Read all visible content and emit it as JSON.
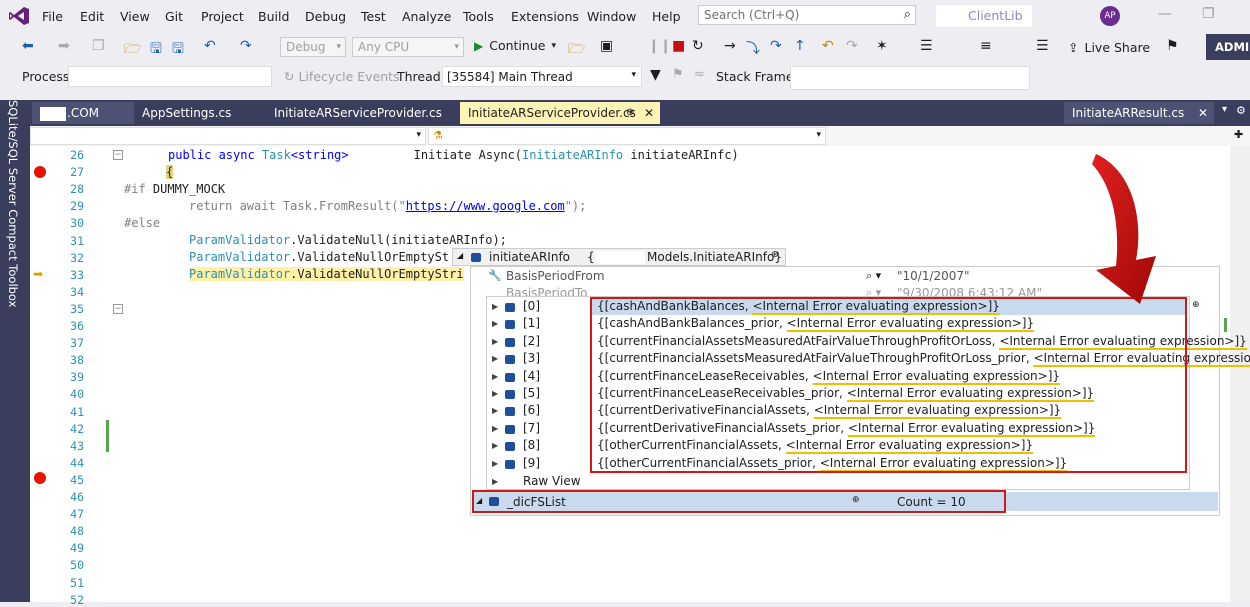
{
  "menu": [
    "File",
    "Edit",
    "View",
    "Git",
    "Project",
    "Build",
    "Debug",
    "Test",
    "Analyze",
    "Tools",
    "Extensions",
    "Window",
    "Help"
  ],
  "search": {
    "placeholder": "Search (Ctrl+Q)"
  },
  "solution_name": "ClientLib",
  "avatar_initials": "AP",
  "toolbar": {
    "config": "Debug",
    "platform": "Any CPU",
    "continue_label": "Continue",
    "live_share": "Live Share",
    "admin": "ADMIN"
  },
  "process_bar": {
    "process_label": "Process:",
    "lifecycle_label": "Lifecycle Events",
    "thread_label": "Thread:",
    "thread_value": "[35584] Main Thread",
    "stack_label": "Stack Frame:"
  },
  "sidebar_title": "SQLite/SQL Server Compact Toolbox",
  "tabs": [
    {
      "label": ".COM"
    },
    {
      "label": "AppSettings.cs"
    },
    {
      "label": "InitiateARServiceProvider.cs"
    },
    {
      "label": "InitiateARServiceProvider.cs"
    },
    {
      "label": "InitiateARResult.cs"
    }
  ],
  "lines": [
    "26",
    "27",
    "28",
    "29",
    "30",
    "31",
    "32",
    "33",
    "34",
    "35",
    "36",
    "37",
    "38",
    "39",
    "40",
    "41",
    "42",
    "43",
    "44",
    "45",
    "46",
    "47",
    "48",
    "49",
    "50",
    "51",
    "52"
  ],
  "code": {
    "l26a": "public async ",
    "l26b": "Task",
    "l26c": "<string>",
    "l26d": "         Initiate Async(",
    "l26e": "InitiateARInfo",
    "l26f": " initiateARInfc)",
    "l27": "{",
    "l28a": "#if",
    "l28b": " DUMMY_MOCK",
    "l29a": "return await ",
    "l29b": "Task",
    "l29c": ".FromResult(\"",
    "l29d": "https://www.google.com",
    "l29e": "\");",
    "l30": "#else",
    "l31a": "ParamValidator",
    "l31b": ".ValidateNull(initiateARInfo);",
    "l32a": "ParamValidator",
    "l32b": ".ValidateNullOrEmptySt",
    "l33a": "ParamValidator",
    "l33b": ".ValidateNullOrEmptyStri"
  },
  "datatip": {
    "header_name": "initiateARInfo",
    "header_value": "Models.InitiateARInfo}",
    "header_value_prefix": "{",
    "basis_from": "BasisPeriodFrom",
    "basis_to": "BasisPeriodTo",
    "basis_from_value": "\"10/1/2007\"",
    "basis_to_value": "\"9/30/2008 6:43:12 AM\"",
    "items": [
      {
        "index": "[0]",
        "key": "{[cashAndBankBalances, ",
        "err": "<Internal Error evaluating expression>]}"
      },
      {
        "index": "[1]",
        "key": "{[cashAndBankBalances_prior, ",
        "err": "<Internal Error evaluating expression>]}"
      },
      {
        "index": "[2]",
        "key": "{[currentFinancialAssetsMeasuredAtFairValueThroughProfitOrLoss, ",
        "err": "<Internal Error evaluating expression>]}"
      },
      {
        "index": "[3]",
        "key": "{[currentFinancialAssetsMeasuredAtFairValueThroughProfitOrLoss_prior, ",
        "err": "<Internal Error evaluating expression>]}"
      },
      {
        "index": "[4]",
        "key": "{[currentFinanceLeaseReceivables, ",
        "err": "<Internal Error evaluating expression>]}"
      },
      {
        "index": "[5]",
        "key": "{[currentFinanceLeaseReceivables_prior, ",
        "err": "<Internal Error evaluating expression>]}"
      },
      {
        "index": "[6]",
        "key": "{[currentDerivativeFinancialAssets, ",
        "err": "<Internal Error evaluating expression>]}"
      },
      {
        "index": "[7]",
        "key": "{[currentDerivativeFinancialAssets_prior, ",
        "err": "<Internal Error evaluating expression>]}"
      },
      {
        "index": "[8]",
        "key": "{[otherCurrentFinancialAssets, ",
        "err": "<Internal Error evaluating expression>]}"
      },
      {
        "index": "[9]",
        "key": "{[otherCurrentFinancialAssets_prior, ",
        "err": "<Internal Error evaluating expression>]}"
      }
    ],
    "raw_view": "Raw View",
    "dic_name": "_dicFSList",
    "dic_value": "Count = 10"
  },
  "colors": {
    "accent": "#3a3d5c",
    "active_tab": "#fff2b5",
    "annotation": "#d01818",
    "underline": "#f0c000"
  }
}
